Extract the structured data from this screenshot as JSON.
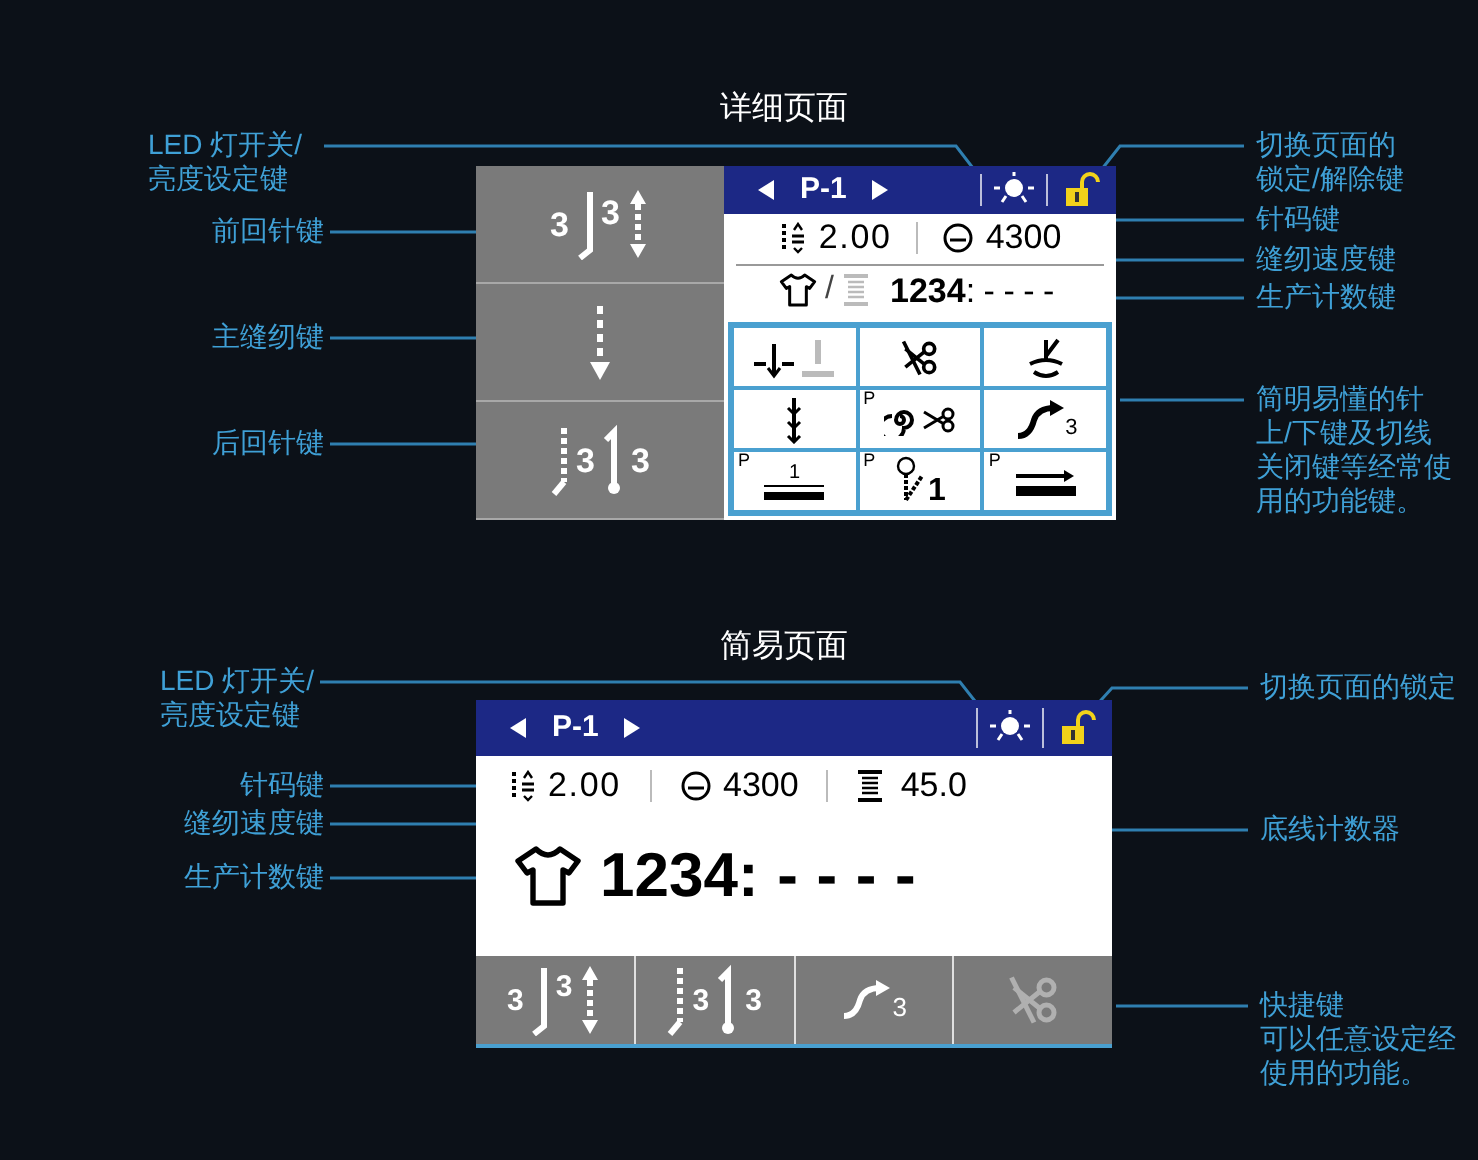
{
  "detail_page": {
    "title": "详细页面",
    "page": "P-1",
    "stitch_length": "2.00",
    "speed": "4300",
    "counter_separator": "/",
    "count": "1234",
    "count_suffix": ":----",
    "side_keys": [
      {
        "kind": "start_backtack",
        "digits": [
          "3",
          "3"
        ]
      },
      {
        "kind": "sewing"
      },
      {
        "kind": "end_backtack",
        "digits": [
          "3",
          "3"
        ]
      }
    ],
    "function_keys": [
      {
        "kind": "needle_up_down"
      },
      {
        "kind": "trim"
      },
      {
        "kind": "presser"
      },
      {
        "kind": "stitch"
      },
      {
        "kind": "thread_trim",
        "tag": "P"
      },
      {
        "kind": "slow_start",
        "digit": "3"
      },
      {
        "kind": "counter",
        "tag": "P",
        "digit": "1"
      },
      {
        "kind": "needle_position",
        "tag": "P",
        "digit": "1"
      },
      {
        "kind": "thread_feed",
        "tag": "P"
      }
    ],
    "left_callouts": [
      {
        "lines": [
          "LED 灯开关/",
          "亮度设定键"
        ]
      },
      {
        "lines": [
          "前回针键"
        ]
      },
      {
        "lines": [
          "主缝纫键"
        ]
      },
      {
        "lines": [
          "后回针键"
        ]
      }
    ],
    "right_callouts": [
      {
        "lines": [
          "切换页面的",
          "锁定/解除键"
        ]
      },
      {
        "lines": [
          "针码键"
        ]
      },
      {
        "lines": [
          "缝纫速度键"
        ]
      },
      {
        "lines": [
          "生产计数键"
        ]
      },
      {
        "lines": [
          "简明易懂的针",
          "上/下键及切线",
          "关闭键等经常使",
          "用的功能键。"
        ]
      }
    ]
  },
  "simple_page": {
    "title": "简易页面",
    "page": "P-1",
    "stitch_length": "2.00",
    "speed": "4300",
    "bobbin_count": "45.0",
    "count": "1234",
    "count_suffix": ":----",
    "shortcut_keys": [
      {
        "kind": "start_backtack",
        "digits": [
          "3",
          "3"
        ],
        "disabled": false
      },
      {
        "kind": "end_backtack",
        "digits": [
          "3",
          "3"
        ],
        "disabled": false
      },
      {
        "kind": "slow_start",
        "digit": "3",
        "disabled": false
      },
      {
        "kind": "trim",
        "disabled": true
      }
    ],
    "left_callouts": [
      {
        "lines": [
          "LED 灯开关/",
          "亮度设定键"
        ]
      },
      {
        "lines": [
          "针码键"
        ]
      },
      {
        "lines": [
          "缝纫速度键"
        ]
      },
      {
        "lines": [
          "生产计数键"
        ]
      }
    ],
    "right_callouts": [
      {
        "lines": [
          "切换页面的锁定"
        ]
      },
      {
        "lines": [
          "底线计数器"
        ]
      },
      {
        "lines": [
          "快捷键",
          "可以任意设定经",
          "使用的功能。"
        ]
      }
    ]
  }
}
